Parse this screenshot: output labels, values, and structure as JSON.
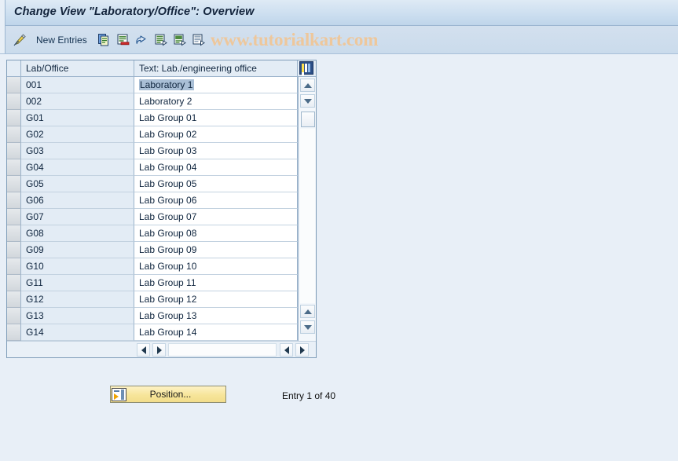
{
  "window": {
    "title": "Change View \"Laboratory/Office\": Overview"
  },
  "watermark": {
    "text": "www.tutorialkart.com",
    "color": "#eec79b"
  },
  "toolbar": {
    "items": [
      {
        "name": "change-pencil-icon",
        "label": "",
        "icon": "pencil-icon"
      },
      {
        "name": "new-entries-button",
        "label": "New Entries",
        "icon": ""
      },
      {
        "name": "copy-as-button",
        "label": "",
        "icon": "copy-icon"
      },
      {
        "name": "delete-button",
        "label": "",
        "icon": "delete-icon"
      },
      {
        "name": "undo-button",
        "label": "",
        "icon": "undo-icon"
      },
      {
        "name": "select-all-button",
        "label": "",
        "icon": "select-all-icon"
      },
      {
        "name": "select-block-button",
        "label": "",
        "icon": "select-block-icon"
      },
      {
        "name": "deselect-all-button",
        "label": "",
        "icon": "deselect-all-icon"
      }
    ],
    "new_entries_label": "New Entries"
  },
  "table": {
    "columns": [
      {
        "key": "code",
        "header": "Lab/Office"
      },
      {
        "key": "text",
        "header": "Text: Lab./engineering office"
      }
    ],
    "settings_icon": "column-config-icon",
    "selected_row_index": 0,
    "selected_cell_text": "Laboratory 1",
    "rows": [
      {
        "code": "001",
        "text": "Laboratory 1"
      },
      {
        "code": "002",
        "text": "Laboratory 2"
      },
      {
        "code": "G01",
        "text": "Lab Group 01"
      },
      {
        "code": "G02",
        "text": "Lab Group 02"
      },
      {
        "code": "G03",
        "text": "Lab Group 03"
      },
      {
        "code": "G04",
        "text": "Lab Group 04"
      },
      {
        "code": "G05",
        "text": "Lab Group 05"
      },
      {
        "code": "G06",
        "text": "Lab Group 06"
      },
      {
        "code": "G07",
        "text": "Lab Group 07"
      },
      {
        "code": "G08",
        "text": "Lab Group 08"
      },
      {
        "code": "G09",
        "text": "Lab Group 09"
      },
      {
        "code": "G10",
        "text": "Lab Group 10"
      },
      {
        "code": "G11",
        "text": "Lab Group 11"
      },
      {
        "code": "G12",
        "text": "Lab Group 12"
      },
      {
        "code": "G13",
        "text": "Lab Group 13"
      },
      {
        "code": "G14",
        "text": "Lab Group 14"
      }
    ]
  },
  "footer": {
    "position_button_label": "Position...",
    "entry_status": "Entry 1 of 40"
  },
  "colors": {
    "background": "#e8eff7",
    "title_bar": "#cddff0",
    "key_column": "#e3ecf5",
    "selection": "#a9bfd6",
    "button_yellow": "#f7e59a"
  }
}
